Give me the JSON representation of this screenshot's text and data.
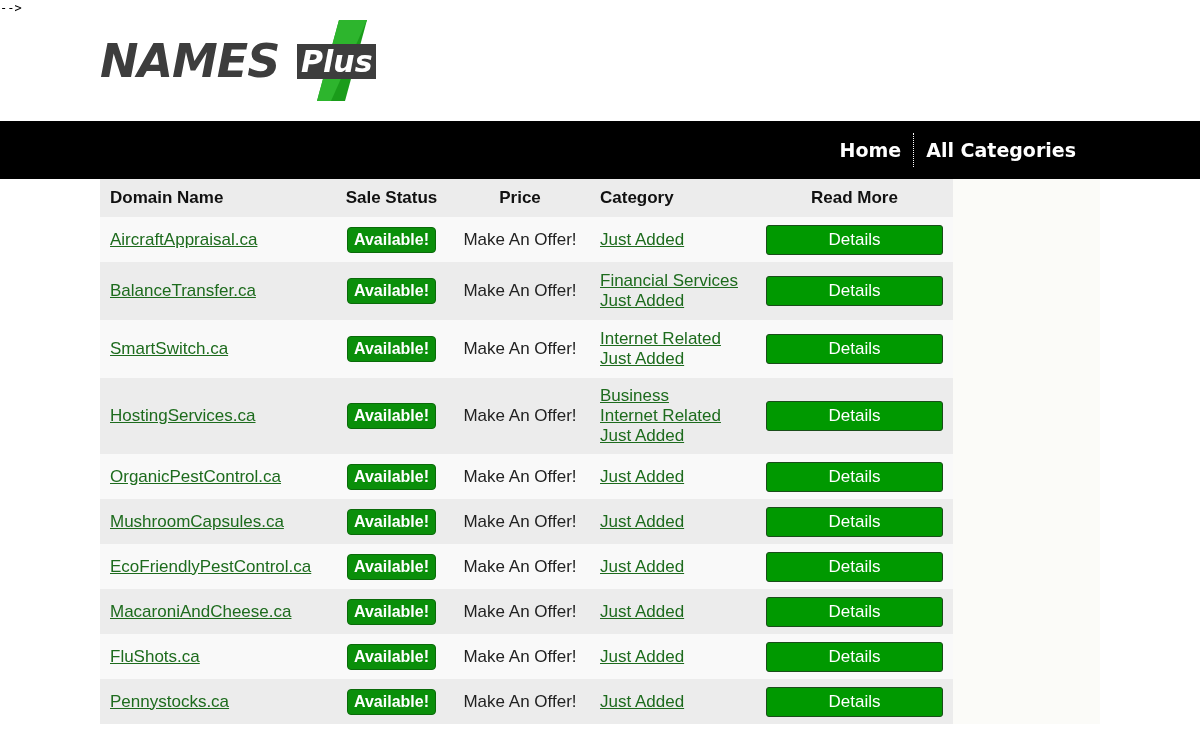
{
  "comment_residue": "-->",
  "logo": {
    "word": "NAMES",
    "badge": "Plus"
  },
  "nav": [
    {
      "label": "Home"
    },
    {
      "label": "All Categories"
    }
  ],
  "table": {
    "columns": [
      "Domain Name",
      "Sale Status",
      "Price",
      "Category",
      "Read More"
    ],
    "rows": [
      {
        "domain": "AircraftAppraisal.ca",
        "status": "Available!",
        "price": "Make An Offer!",
        "categories": [
          "Just Added"
        ],
        "action": "Details"
      },
      {
        "domain": "BalanceTransfer.ca",
        "status": "Available!",
        "price": "Make An Offer!",
        "categories": [
          "Financial Services",
          "Just Added"
        ],
        "action": "Details"
      },
      {
        "domain": "SmartSwitch.ca",
        "status": "Available!",
        "price": "Make An Offer!",
        "categories": [
          "Internet Related",
          "Just Added"
        ],
        "action": "Details"
      },
      {
        "domain": "HostingServices.ca",
        "status": "Available!",
        "price": "Make An Offer!",
        "categories": [
          "Business",
          "Internet Related",
          "Just Added"
        ],
        "action": "Details"
      },
      {
        "domain": "OrganicPestControl.ca",
        "status": "Available!",
        "price": "Make An Offer!",
        "categories": [
          "Just Added"
        ],
        "action": "Details"
      },
      {
        "domain": "MushroomCapsules.ca",
        "status": "Available!",
        "price": "Make An Offer!",
        "categories": [
          "Just Added"
        ],
        "action": "Details"
      },
      {
        "domain": "EcoFriendlyPestControl.ca",
        "status": "Available!",
        "price": "Make An Offer!",
        "categories": [
          "Just Added"
        ],
        "action": "Details"
      },
      {
        "domain": "MacaroniAndCheese.ca",
        "status": "Available!",
        "price": "Make An Offer!",
        "categories": [
          "Just Added"
        ],
        "action": "Details"
      },
      {
        "domain": "FluShots.ca",
        "status": "Available!",
        "price": "Make An Offer!",
        "categories": [
          "Just Added"
        ],
        "action": "Details"
      },
      {
        "domain": "Pennystocks.ca",
        "status": "Available!",
        "price": "Make An Offer!",
        "categories": [
          "Just Added"
        ],
        "action": "Details"
      }
    ]
  }
}
